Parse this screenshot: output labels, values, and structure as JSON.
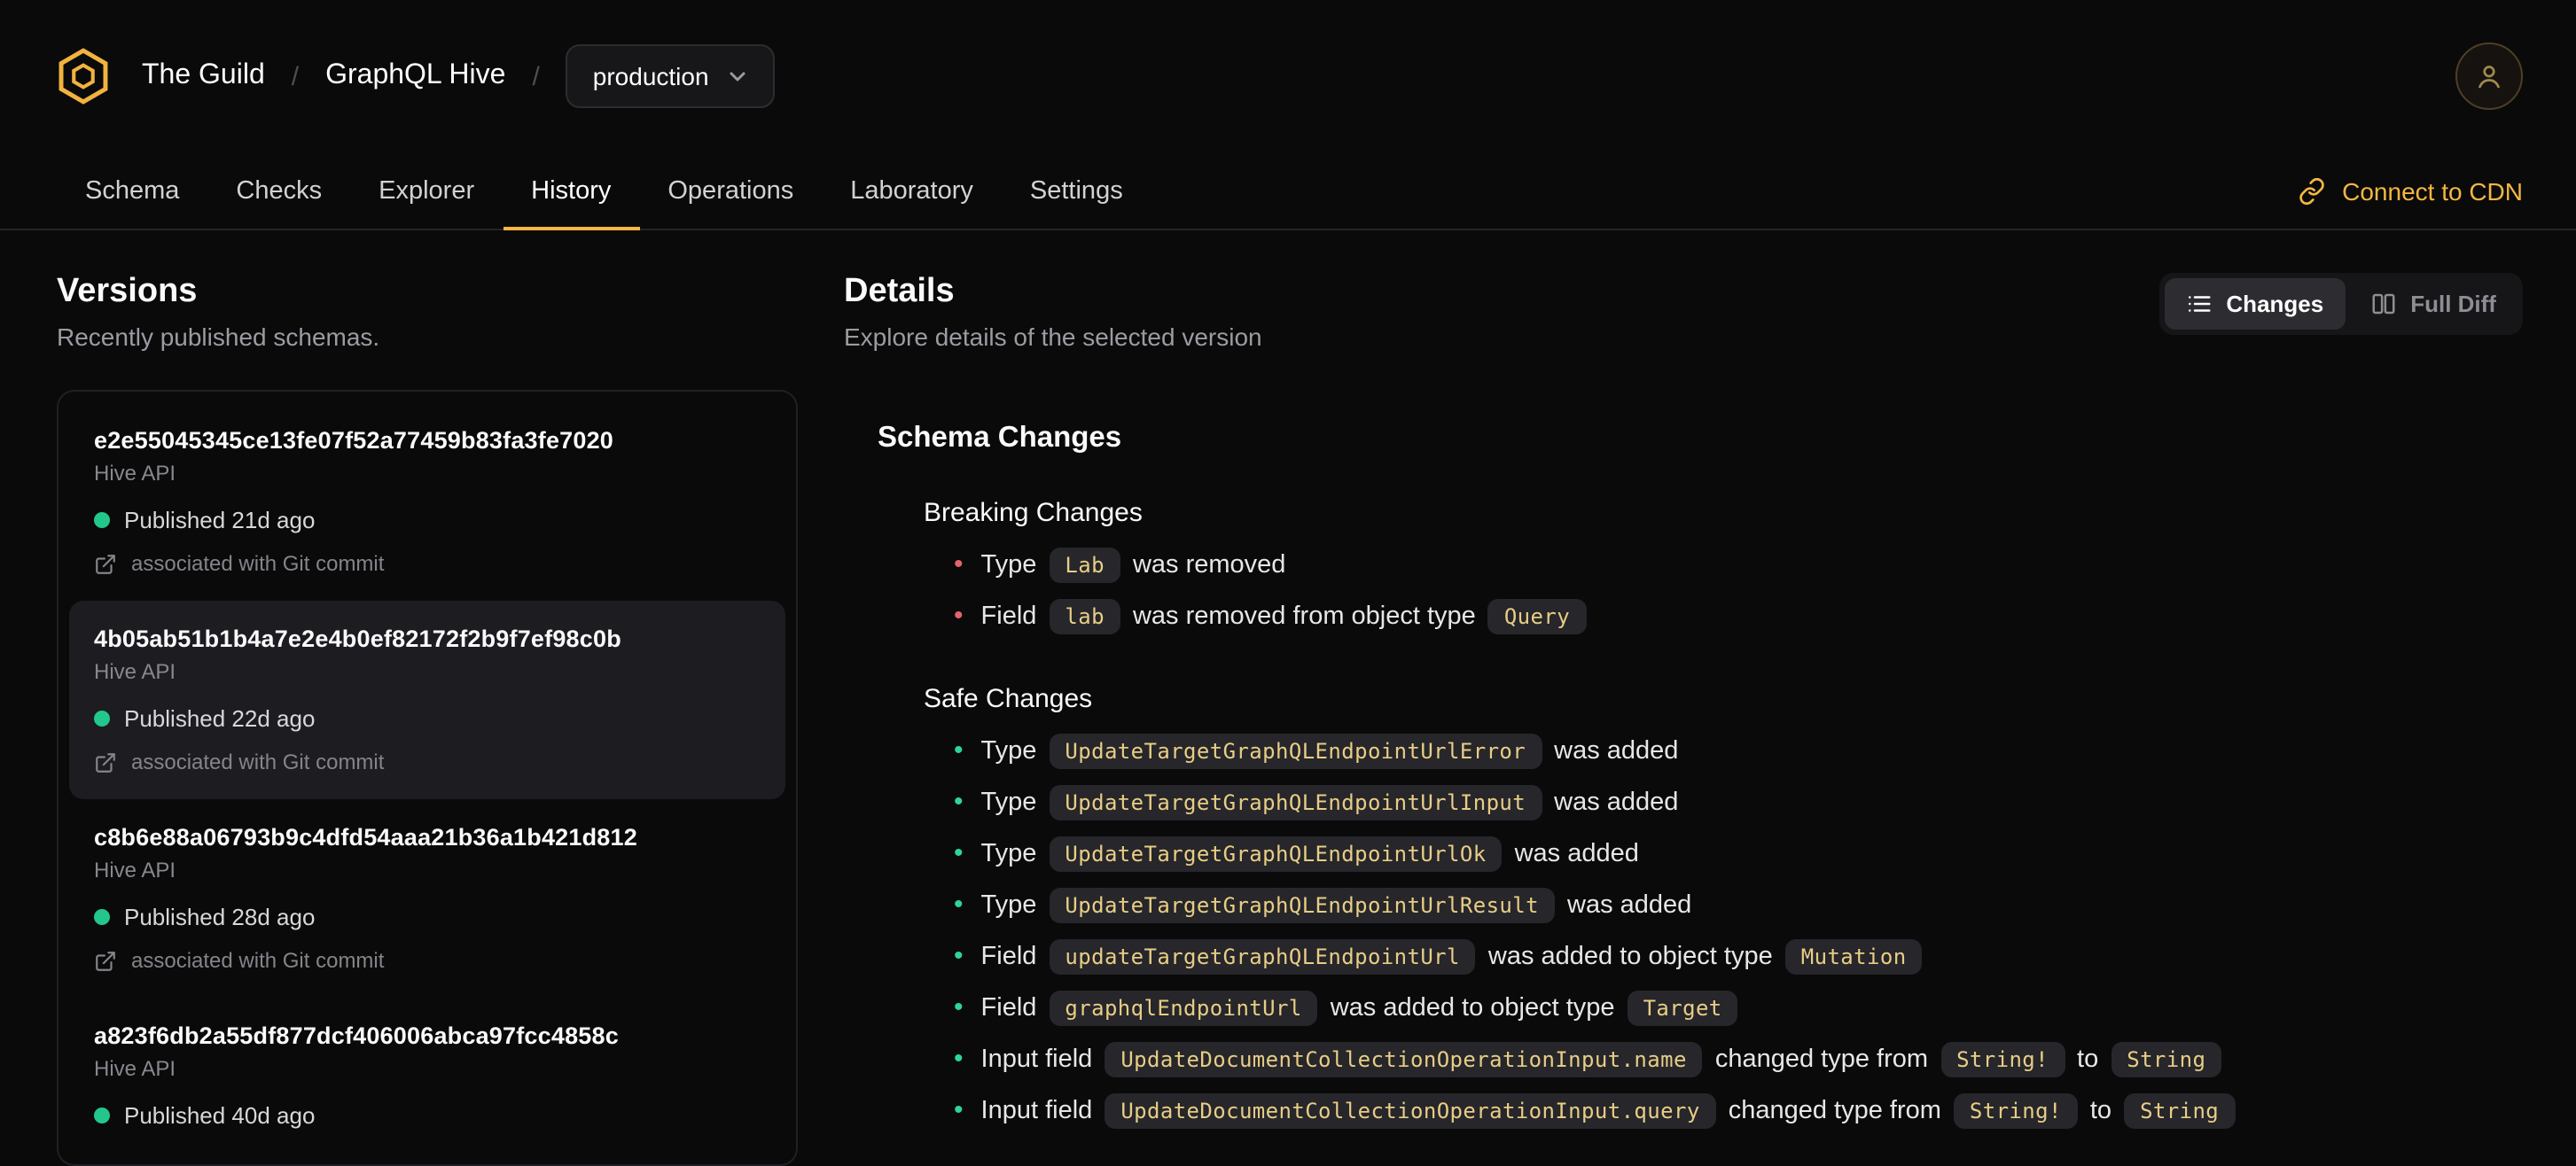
{
  "colors": {
    "page_bg": "#0a0a0a",
    "accent": "#f4b740",
    "breaking_bullet": "#e5636c",
    "safe_bullet": "#2dd4a0",
    "published_dot": "#23c78b",
    "code_bg": "#26262b",
    "code_text": "#e8cd85"
  },
  "header": {
    "org": "The Guild",
    "separator": "/",
    "project": "GraphQL Hive",
    "target_selector": "production"
  },
  "nav": {
    "tabs": [
      {
        "label": "Schema",
        "active": false
      },
      {
        "label": "Checks",
        "active": false
      },
      {
        "label": "Explorer",
        "active": false
      },
      {
        "label": "History",
        "active": true
      },
      {
        "label": "Operations",
        "active": false
      },
      {
        "label": "Laboratory",
        "active": false
      },
      {
        "label": "Settings",
        "active": false
      }
    ],
    "cdn_link": "Connect to CDN"
  },
  "versions": {
    "title": "Versions",
    "subtitle": "Recently published schemas.",
    "items": [
      {
        "hash": "e2e55045345ce13fe07f52a77459b83fa3fe7020",
        "service": "Hive API",
        "published": "Published 21d ago",
        "git": "associated with Git commit",
        "selected": false
      },
      {
        "hash": "4b05ab51b1b4a7e2e4b0ef82172f2b9f7ef98c0b",
        "service": "Hive API",
        "published": "Published 22d ago",
        "git": "associated with Git commit",
        "selected": true
      },
      {
        "hash": "c8b6e88a06793b9c4dfd54aaa21b36a1b421d812",
        "service": "Hive API",
        "published": "Published 28d ago",
        "git": "associated with Git commit",
        "selected": false
      },
      {
        "hash": "a823f6db2a55df877dcf406006abca97fcc4858c",
        "service": "Hive API",
        "published": "Published 40d ago",
        "git": null,
        "selected": false
      }
    ]
  },
  "details": {
    "title": "Details",
    "subtitle": "Explore details of the selected version",
    "view_toggle": [
      {
        "label": "Changes",
        "icon": "list-icon",
        "active": true
      },
      {
        "label": "Full Diff",
        "icon": "columns-icon",
        "active": false
      }
    ],
    "schema_changes_title": "Schema Changes",
    "breaking": {
      "title": "Breaking Changes",
      "items": [
        [
          {
            "t": "text",
            "v": "Type"
          },
          {
            "t": "code",
            "v": "Lab"
          },
          {
            "t": "text",
            "v": "was removed"
          }
        ],
        [
          {
            "t": "text",
            "v": "Field"
          },
          {
            "t": "code",
            "v": "lab"
          },
          {
            "t": "text",
            "v": "was removed from object type"
          },
          {
            "t": "code",
            "v": "Query"
          }
        ]
      ]
    },
    "safe": {
      "title": "Safe Changes",
      "items": [
        [
          {
            "t": "text",
            "v": "Type"
          },
          {
            "t": "code",
            "v": "UpdateTargetGraphQLEndpointUrlError"
          },
          {
            "t": "text",
            "v": "was added"
          }
        ],
        [
          {
            "t": "text",
            "v": "Type"
          },
          {
            "t": "code",
            "v": "UpdateTargetGraphQLEndpointUrlInput"
          },
          {
            "t": "text",
            "v": "was added"
          }
        ],
        [
          {
            "t": "text",
            "v": "Type"
          },
          {
            "t": "code",
            "v": "UpdateTargetGraphQLEndpointUrlOk"
          },
          {
            "t": "text",
            "v": "was added"
          }
        ],
        [
          {
            "t": "text",
            "v": "Type"
          },
          {
            "t": "code",
            "v": "UpdateTargetGraphQLEndpointUrlResult"
          },
          {
            "t": "text",
            "v": "was added"
          }
        ],
        [
          {
            "t": "text",
            "v": "Field"
          },
          {
            "t": "code",
            "v": "updateTargetGraphQLEndpointUrl"
          },
          {
            "t": "text",
            "v": "was added to object type"
          },
          {
            "t": "code",
            "v": "Mutation"
          }
        ],
        [
          {
            "t": "text",
            "v": "Field"
          },
          {
            "t": "code",
            "v": "graphqlEndpointUrl"
          },
          {
            "t": "text",
            "v": "was added to object type"
          },
          {
            "t": "code",
            "v": "Target"
          }
        ],
        [
          {
            "t": "text",
            "v": "Input field"
          },
          {
            "t": "code",
            "v": "UpdateDocumentCollectionOperationInput.name"
          },
          {
            "t": "text",
            "v": "changed type from"
          },
          {
            "t": "code",
            "v": "String!"
          },
          {
            "t": "text",
            "v": "to"
          },
          {
            "t": "code",
            "v": "String"
          }
        ],
        [
          {
            "t": "text",
            "v": "Input field"
          },
          {
            "t": "code",
            "v": "UpdateDocumentCollectionOperationInput.query"
          },
          {
            "t": "text",
            "v": "changed type from"
          },
          {
            "t": "code",
            "v": "String!"
          },
          {
            "t": "text",
            "v": "to"
          },
          {
            "t": "code",
            "v": "String"
          }
        ]
      ]
    }
  }
}
